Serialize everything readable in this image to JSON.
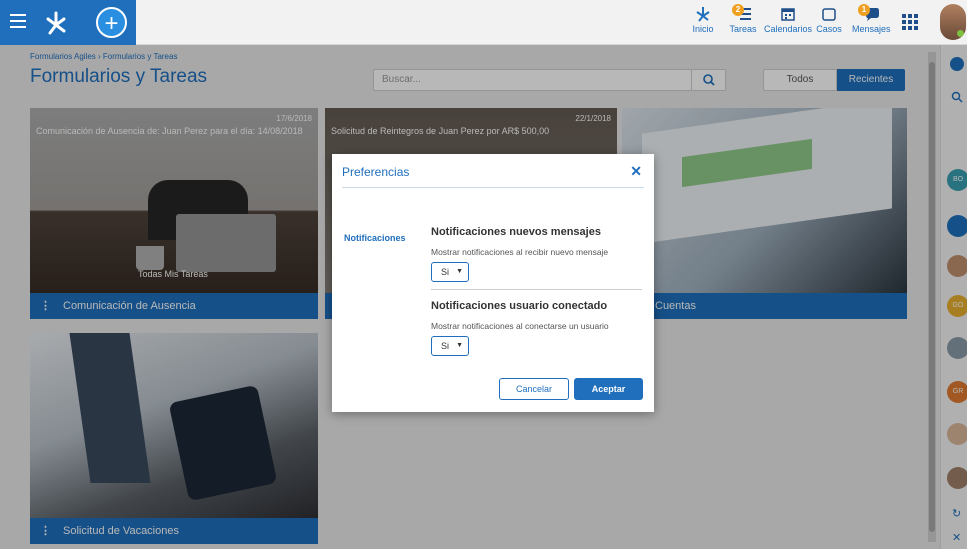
{
  "topbar": {
    "nav": [
      {
        "label": "Inicio",
        "icon": "home-icon"
      },
      {
        "label": "Tareas",
        "icon": "tasks-icon",
        "badge": "2"
      },
      {
        "label": "Calendarios",
        "icon": "calendar-icon"
      },
      {
        "label": "Casos",
        "icon": "cases-icon"
      },
      {
        "label": "Mensajes",
        "icon": "messages-icon",
        "badge": "1"
      }
    ],
    "accent": "#1f6fbd"
  },
  "header": {
    "breadcrumb": "Formularios Agiles › Formularios y Tareas",
    "title": "Formularios y Tareas",
    "search_placeholder": "Buscar...",
    "filters": [
      "Todos",
      "Recientes"
    ],
    "active_filter": "Recientes"
  },
  "cards": [
    {
      "date": "17/6/2018",
      "title": "Comunicación de Ausencia de: Juan Perez para el día: 14/08/2018",
      "footer": "Comunicación de Ausencia",
      "caption": "Todas Mis Tareas"
    },
    {
      "date": "22/1/2018",
      "title": "Solicitud de Reintegros de Juan Perez por AR$ 500,00",
      "footer": ""
    },
    {
      "date": "",
      "title": "",
      "footer": "Cuentas"
    },
    {
      "date": "",
      "title": "",
      "footer": "Solicitud de Vacaciones"
    }
  ],
  "sidebar_right": {
    "avatars": [
      "BO",
      "",
      "",
      "GO",
      "",
      "GR",
      "",
      ""
    ]
  },
  "modal": {
    "title": "Preferencias",
    "side_label": "Notificaciones",
    "sections": [
      {
        "title": "Notificaciones nuevos mensajes",
        "desc": "Mostrar notificaciones al recibir nuevo mensaje",
        "value": "Si"
      },
      {
        "title": "Notificaciones usuario conectado",
        "desc": "Mostrar notificaciones al conectarse un usuario",
        "value": "Si"
      }
    ],
    "cancel_label": "Cancelar",
    "accept_label": "Aceptar"
  }
}
